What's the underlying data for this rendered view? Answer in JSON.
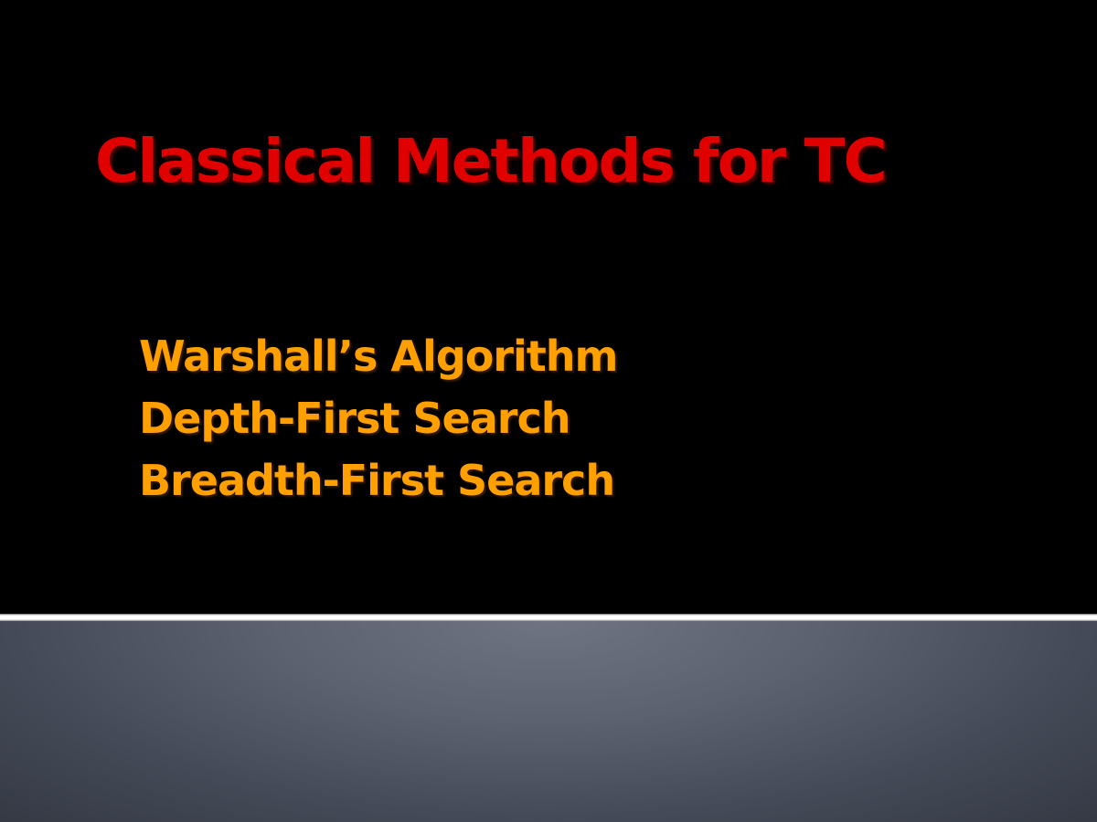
{
  "slide": {
    "title": "Classical Methods for TC",
    "items": [
      "Warshall’s Algorithm",
      "Depth-First Search",
      "Breadth-First Search"
    ]
  },
  "colors": {
    "background": "#000000",
    "title": "#e00000",
    "items": "#ffa000",
    "divider": "#ffffff",
    "footer": "#5c6270"
  }
}
